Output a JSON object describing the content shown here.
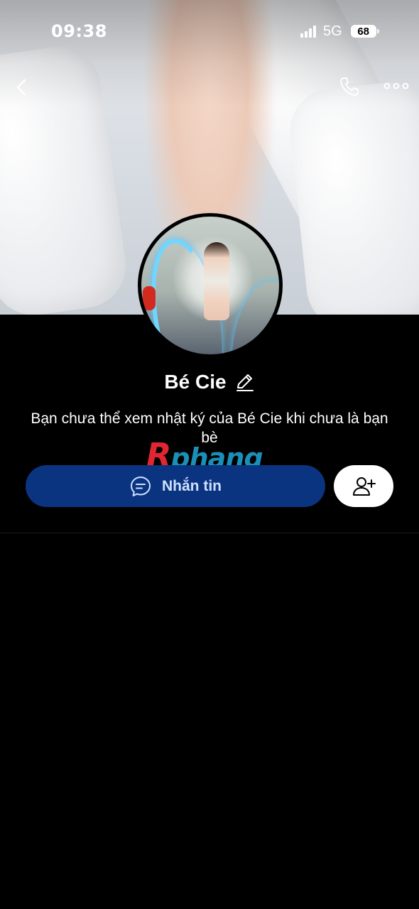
{
  "status_bar": {
    "time": "09:38",
    "network": "5G",
    "battery": "68",
    "signal_icon": "cellular-signal-icon",
    "battery_icon": "battery-icon"
  },
  "top_nav": {
    "back_icon": "chevron-left-icon",
    "call_icon": "phone-icon",
    "more_icon": "more-dots-icon"
  },
  "profile": {
    "name": "Bé Cie",
    "edit_icon": "pencil-icon",
    "notice": "Bạn chưa thể xem nhật ký của Bé Cie khi chưa là bạn bè"
  },
  "watermark": {
    "first": "R",
    "rest": "phang"
  },
  "actions": {
    "message_label": "Nhắn tin",
    "message_icon": "chat-bubble-icon",
    "add_friend_icon": "add-friend-icon"
  },
  "colors": {
    "background": "#000000",
    "message_button": "#0a3480",
    "message_text": "#cfe0ff",
    "add_friend_button": "#ffffff",
    "watermark_red": "#e02633",
    "watermark_blue": "#1a8fb8"
  }
}
